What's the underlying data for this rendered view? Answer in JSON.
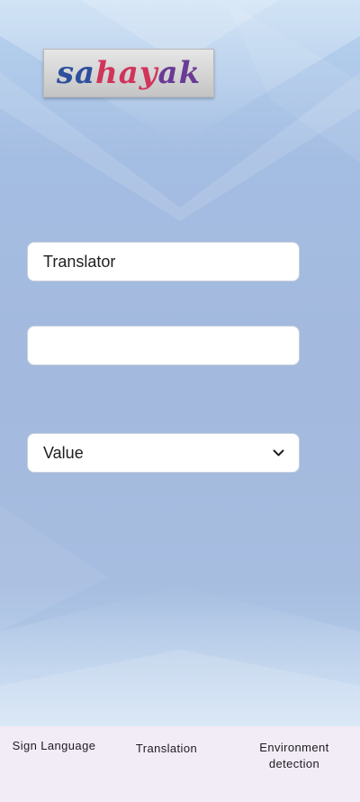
{
  "app": {
    "logo_letters": [
      {
        "text": "sa",
        "color": "#2e4f9c"
      },
      {
        "text": "hay",
        "color": "#d0345a"
      },
      {
        "text": "ak",
        "color": "#6a3a96"
      }
    ]
  },
  "form": {
    "mode_field": {
      "value": "Translator"
    },
    "text_field": {
      "value": ""
    },
    "dropdown": {
      "selected": "Value",
      "icon": "chevron-down-icon"
    }
  },
  "bottom_nav": {
    "items": [
      {
        "label": "Sign Language"
      },
      {
        "label": "Translation"
      },
      {
        "label": "Environment detection"
      }
    ]
  },
  "colors": {
    "background": "#a6bcdf",
    "nav_background": "#f2ecf7",
    "field_background": "#ffffff"
  }
}
